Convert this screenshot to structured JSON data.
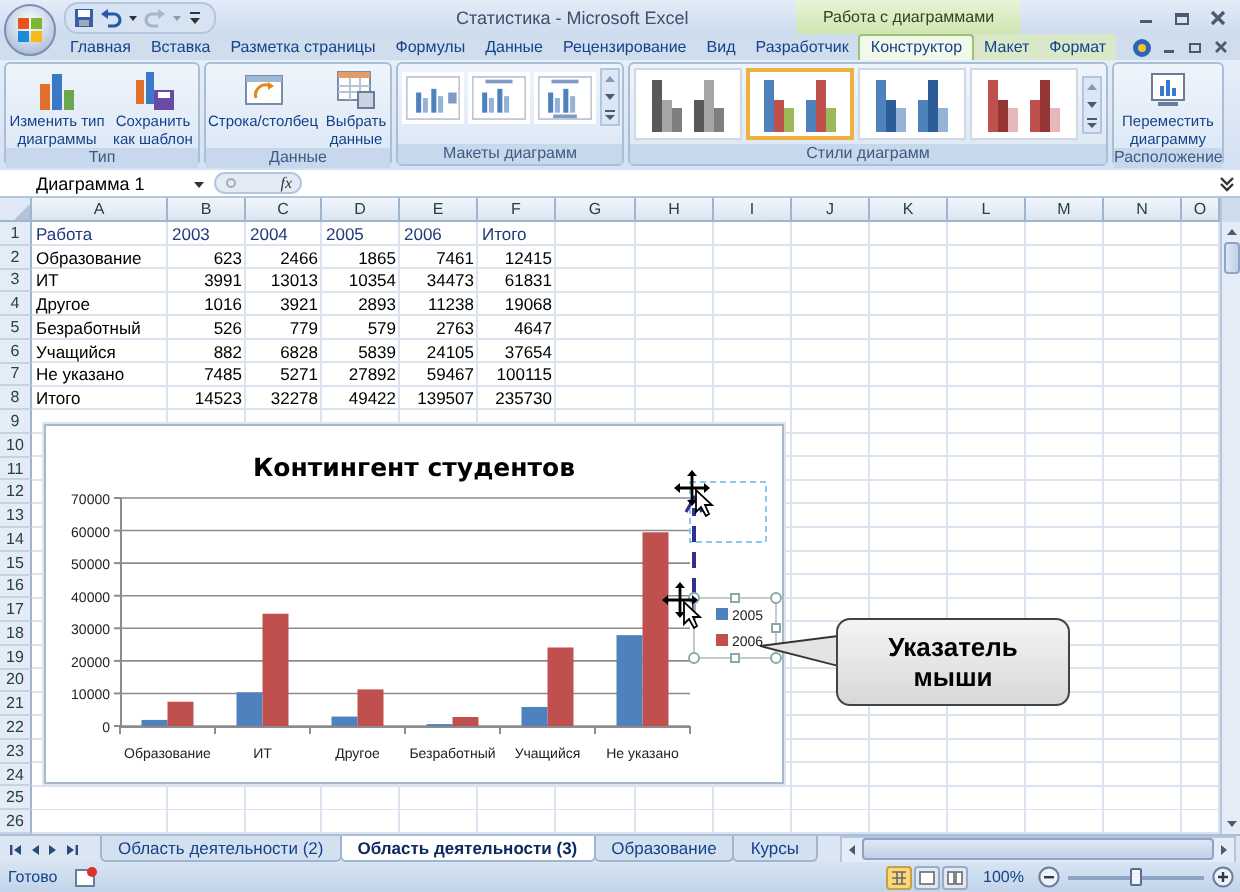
{
  "title_bar": {
    "title": "Статистика - Microsoft Excel",
    "context_label": "Работа с диаграммами"
  },
  "tabs": [
    {
      "label": "Главная",
      "kind": "standard",
      "selected": false
    },
    {
      "label": "Вставка",
      "kind": "standard",
      "selected": false
    },
    {
      "label": "Разметка страницы",
      "kind": "standard",
      "selected": false
    },
    {
      "label": "Формулы",
      "kind": "standard",
      "selected": false
    },
    {
      "label": "Данные",
      "kind": "standard",
      "selected": false
    },
    {
      "label": "Рецензирование",
      "kind": "standard",
      "selected": false
    },
    {
      "label": "Вид",
      "kind": "standard",
      "selected": false
    },
    {
      "label": "Разработчик",
      "kind": "standard",
      "selected": false
    },
    {
      "label": "Конструктор",
      "kind": "context",
      "selected": true
    },
    {
      "label": "Макет",
      "kind": "context",
      "selected": false
    },
    {
      "label": "Формат",
      "kind": "context",
      "selected": false
    }
  ],
  "ribbon": {
    "groups": [
      {
        "label": "Тип",
        "kind": "buttons",
        "buttons": [
          {
            "label": "Изменить тип диаграммы",
            "kind": "change_type"
          },
          {
            "label": "Сохранить как шаблон",
            "kind": "save_template"
          }
        ]
      },
      {
        "label": "Данные",
        "kind": "buttons",
        "buttons": [
          {
            "label": "Строка/столбец",
            "kind": "switch"
          },
          {
            "label": "Выбрать данные",
            "kind": "select_data"
          }
        ]
      },
      {
        "label": "Макеты диаграмм",
        "kind": "layouts",
        "items": [
          {
            "kind": "legend_right"
          },
          {
            "kind": "title_top"
          },
          {
            "kind": "legend_bottom"
          }
        ]
      },
      {
        "label": "Стили диаграмм",
        "kind": "styles",
        "items": [
          {
            "kind": "gray",
            "selected": false
          },
          {
            "kind": "multicolor",
            "selected": true
          },
          {
            "kind": "blue",
            "selected": false
          },
          {
            "kind": "red",
            "selected": false
          }
        ]
      },
      {
        "label": "Расположение",
        "kind": "buttons",
        "buttons": [
          {
            "label": "Переместить диаграмму",
            "kind": "move"
          }
        ]
      }
    ]
  },
  "formula_bar": {
    "name_box": "Диаграмма 1",
    "fx": "fx"
  },
  "sheet": {
    "columns": [
      "A",
      "B",
      "C",
      "D",
      "E",
      "F",
      "G",
      "H",
      "I",
      "J",
      "K",
      "L",
      "M",
      "N",
      "O"
    ],
    "rows": [
      {
        "number": "1",
        "kind": "header",
        "cells": [
          "Работа",
          "2003",
          "2004",
          "2005",
          "2006",
          "Итого"
        ]
      },
      {
        "number": "2",
        "kind": "data",
        "cells": [
          "Образование",
          "623",
          "2466",
          "1865",
          "7461",
          "12415"
        ]
      },
      {
        "number": "3",
        "kind": "data",
        "cells": [
          "ИТ",
          "3991",
          "13013",
          "10354",
          "34473",
          "61831"
        ]
      },
      {
        "number": "4",
        "kind": "data",
        "cells": [
          "Другое",
          "1016",
          "3921",
          "2893",
          "11238",
          "19068"
        ]
      },
      {
        "number": "5",
        "kind": "data",
        "cells": [
          "Безработный",
          "526",
          "779",
          "579",
          "2763",
          "4647"
        ]
      },
      {
        "number": "6",
        "kind": "data",
        "cells": [
          "Учащийся",
          "882",
          "6828",
          "5839",
          "24105",
          "37654"
        ]
      },
      {
        "number": "7",
        "kind": "data",
        "cells": [
          "Не указано",
          "7485",
          "5271",
          "27892",
          "59467",
          "100115"
        ]
      },
      {
        "number": "8",
        "kind": "data",
        "cells": [
          "Итого",
          "14523",
          "32278",
          "49422",
          "139507",
          "235730"
        ]
      },
      {
        "number": "9",
        "kind": "empty"
      },
      {
        "number": "10",
        "kind": "empty"
      },
      {
        "number": "11",
        "kind": "empty"
      },
      {
        "number": "12",
        "kind": "empty"
      },
      {
        "number": "13",
        "kind": "empty"
      },
      {
        "number": "14",
        "kind": "empty"
      },
      {
        "number": "15",
        "kind": "empty"
      },
      {
        "number": "16",
        "kind": "empty"
      },
      {
        "number": "17",
        "kind": "empty"
      },
      {
        "number": "18",
        "kind": "empty"
      },
      {
        "number": "19",
        "kind": "empty"
      },
      {
        "number": "20",
        "kind": "empty"
      },
      {
        "number": "21",
        "kind": "empty"
      },
      {
        "number": "22",
        "kind": "empty"
      },
      {
        "number": "23",
        "kind": "empty"
      },
      {
        "number": "24",
        "kind": "empty"
      },
      {
        "number": "25",
        "kind": "empty"
      },
      {
        "number": "26",
        "kind": "empty"
      }
    ]
  },
  "chart": {
    "chart_data": {
      "type": "bar",
      "title": "Контингент студентов",
      "categories": [
        "Образование",
        "ИТ",
        "Другое",
        "Безработный",
        "Учащийся",
        "Не указано"
      ],
      "series": [
        {
          "name": "2005",
          "color": "#4f81bd",
          "values": [
            1865,
            10354,
            2893,
            579,
            5839,
            27892
          ]
        },
        {
          "name": "2006",
          "color": "#c0504d",
          "values": [
            7461,
            34473,
            11238,
            2763,
            24105,
            59467
          ]
        }
      ],
      "grid": true,
      "legend": true,
      "ylim": [
        0,
        70000
      ],
      "yticks": [
        0,
        10000,
        20000,
        30000,
        40000,
        50000,
        60000,
        70000
      ]
    }
  },
  "callout": {
    "text": "Указатель мыши"
  },
  "sheet_tabs": [
    {
      "label": "Область деятельности (2)",
      "selected": false
    },
    {
      "label": "Область деятельности (3)",
      "selected": true
    },
    {
      "label": "Образование",
      "selected": false
    },
    {
      "label": "Курсы",
      "selected": false
    }
  ],
  "status_bar": {
    "status": "Готово",
    "views": [
      {
        "kind": "normal",
        "selected": true
      },
      {
        "kind": "page_layout",
        "selected": false
      },
      {
        "kind": "page_break",
        "selected": false
      }
    ],
    "zoom": "100%",
    "zoom_slider": {
      "level": 0.5
    }
  }
}
